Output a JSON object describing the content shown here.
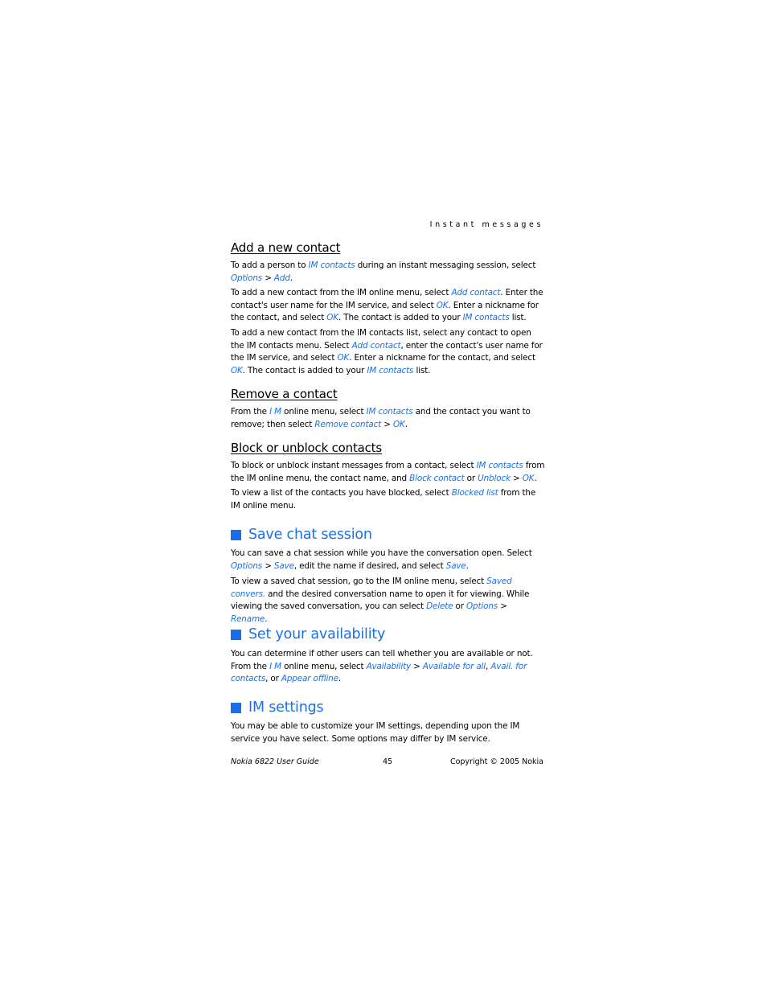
{
  "running_head": "Instant messages",
  "sections": {
    "add_contact": {
      "heading": "Add a new contact",
      "p1": [
        "To add a person to ",
        {
          "link": "IM contacts"
        },
        " during an instant messaging session, select ",
        {
          "link": "Options"
        },
        " > ",
        {
          "link": "Add"
        },
        "."
      ],
      "p2": [
        "To add a new contact from the IM online menu, select ",
        {
          "link": "Add contact"
        },
        ". Enter the contact's user name for the IM service, and select ",
        {
          "link": "OK"
        },
        ". Enter a nickname for the contact, and select ",
        {
          "link": "OK"
        },
        ". The contact is added to your ",
        {
          "link": "IM contacts"
        },
        " list."
      ],
      "p3": [
        "To add a new contact from the IM contacts list, select any contact to open the IM contacts menu. Select ",
        {
          "link": "Add contact"
        },
        ", enter the contact's user name for the IM service, and select ",
        {
          "link": "OK"
        },
        ". Enter a nickname for the contact, and select ",
        {
          "link": "OK"
        },
        ". The contact is added to your ",
        {
          "link": "IM contacts"
        },
        " list."
      ]
    },
    "remove_contact": {
      "heading": "Remove a contact",
      "p1": [
        "From the ",
        {
          "link": "I M"
        },
        " online menu, select ",
        {
          "link": "IM contacts"
        },
        " and the contact you want to remove; then select ",
        {
          "link": "Remove contact"
        },
        " > ",
        {
          "link": "OK"
        },
        "."
      ]
    },
    "block_contacts": {
      "heading": "Block or unblock contacts",
      "p1": [
        "To block or unblock instant messages from a contact, select ",
        {
          "link": "IM contacts"
        },
        " from the IM online menu, the contact name, and ",
        {
          "link": "Block contact"
        },
        " or ",
        {
          "link": "Unblock"
        },
        " > ",
        {
          "link": "OK"
        },
        "."
      ],
      "p2": [
        "To view a list of the contacts you have blocked, select ",
        {
          "link": "Blocked list"
        },
        " from the IM online menu."
      ]
    },
    "save_chat": {
      "heading": "Save chat session",
      "p1": [
        "You can save a chat session while you have the conversation open. Select ",
        {
          "link": "Options"
        },
        " > ",
        {
          "link": "Save"
        },
        ", edit the name if desired, and select ",
        {
          "link": "Save"
        },
        "."
      ],
      "p2": [
        "To view a saved chat session, go to the IM online menu, select ",
        {
          "link": "Saved convers."
        },
        " and the desired conversation name to open it for viewing. While viewing the saved conversation, you can select ",
        {
          "link": "Delete"
        },
        " or ",
        {
          "link": "Options"
        },
        " > ",
        {
          "link": "Rename"
        },
        "."
      ]
    },
    "availability": {
      "heading": "Set your availability",
      "p1": [
        "You can determine if other users can tell whether you are available or not. From the ",
        {
          "link": "I M"
        },
        " online menu, select ",
        {
          "link": "Availability"
        },
        " > ",
        {
          "link": "Available for all"
        },
        ", ",
        {
          "link": "Avail. for contacts"
        },
        ", or ",
        {
          "link": "Appear offline"
        },
        "."
      ]
    },
    "im_settings": {
      "heading": "IM settings",
      "p1": [
        "You may be able to customize your IM settings, depending upon the IM service you have select. Some options may differ by IM service."
      ]
    }
  },
  "footer": {
    "guide": "Nokia 6822 User Guide",
    "page_number": "45",
    "copyright": "Copyright © 2005 Nokia"
  },
  "colors": {
    "accent": "#1a6fe8",
    "text": "#000000"
  }
}
